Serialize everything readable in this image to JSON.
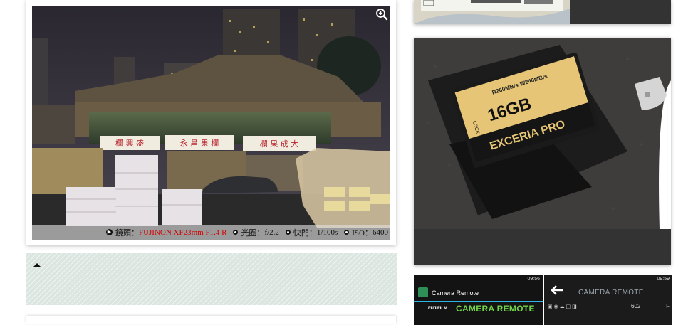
{
  "photo_caption": {
    "lens_label": "鏡頭：",
    "lens_value": "FUJINON XF23mm F1.4 R",
    "aperture_label": "光圈：",
    "aperture_value": "f/2.2",
    "shutter_label": "快門：",
    "shutter_value": "1/100s",
    "iso_label": "ISO：",
    "iso_value": "6400"
  },
  "photo_signs": {
    "sign_1": "欄 興 盛",
    "sign_2": "永 昌 果 欄",
    "sign_3": "欄 果 成 大"
  },
  "sd_card": {
    "speed": "R260MB/s·W240MB/s",
    "capacity": "16GB",
    "brand": "EXCERIA PRO",
    "lock": "LOCK"
  },
  "app_screens": {
    "left_time": "09:56",
    "left_title": "Camera Remote",
    "left_brand_small": "FUJIFILM",
    "left_brand_big": "CAMERA REMOTE",
    "right_time": "09:59",
    "right_title": "CAMERA REMOTE",
    "right_count": "602",
    "right_f": "F"
  },
  "colors": {
    "lens_value": "#d40000",
    "panel_bg": "#dbe6e0",
    "app_accent": "#2fb5e4",
    "brand_green": "#71d349"
  },
  "icons": {
    "zoom": "zoom-in-icon",
    "collapse": "caret-up-icon",
    "back": "back-arrow-icon"
  }
}
